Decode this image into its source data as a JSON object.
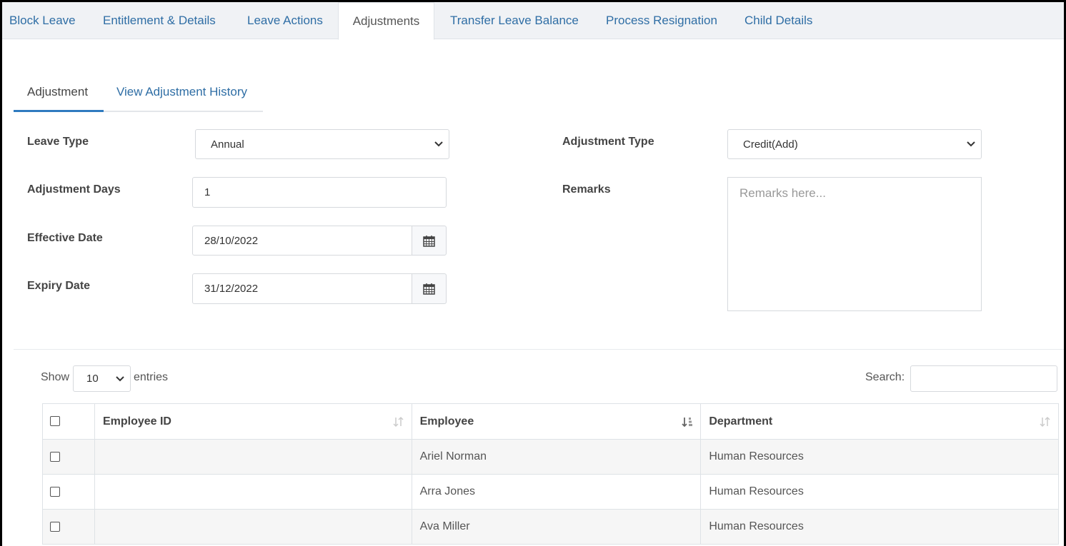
{
  "top_tabs": [
    {
      "label": "Block Leave",
      "active": false
    },
    {
      "label": "Entitlement & Details",
      "active": false
    },
    {
      "label": "Leave Actions",
      "active": false
    },
    {
      "label": "Adjustments",
      "active": true
    },
    {
      "label": "Transfer Leave Balance",
      "active": false
    },
    {
      "label": "Process Resignation",
      "active": false
    },
    {
      "label": "Child Details",
      "active": false
    }
  ],
  "sub_tabs": [
    {
      "label": "Adjustment",
      "active": true
    },
    {
      "label": "View Adjustment History",
      "active": false
    }
  ],
  "form": {
    "leave_type": {
      "label": "Leave Type",
      "value": "Annual"
    },
    "adjustment_days": {
      "label": "Adjustment Days",
      "value": "1"
    },
    "effective_date": {
      "label": "Effective Date",
      "value": "28/10/2022"
    },
    "expiry_date": {
      "label": "Expiry Date",
      "value": "31/12/2022"
    },
    "adjustment_type": {
      "label": "Adjustment Type",
      "value": "Credit(Add)"
    },
    "remarks": {
      "label": "Remarks",
      "placeholder": "Remarks here..."
    }
  },
  "table_controls": {
    "show_label": "Show",
    "entries_value": "10",
    "entries_label": "entries",
    "search_label": "Search:"
  },
  "table": {
    "headers": [
      "Employee ID",
      "Employee",
      "Department"
    ],
    "rows": [
      {
        "employee_id": "",
        "employee": "Ariel Norman",
        "department": "Human Resources"
      },
      {
        "employee_id": "",
        "employee": "Arra Jones",
        "department": "Human Resources"
      },
      {
        "employee_id": "",
        "employee": "Ava Miller",
        "department": "Human Resources"
      }
    ]
  },
  "colors": {
    "link": "#2f6ea5",
    "active_underline": "#2f7bbf",
    "tab_bar_bg": "#f0f2f5"
  },
  "icons": {
    "calendar": "calendar-icon",
    "chevron": "chevron-down-icon",
    "sort": "sort-icon"
  }
}
